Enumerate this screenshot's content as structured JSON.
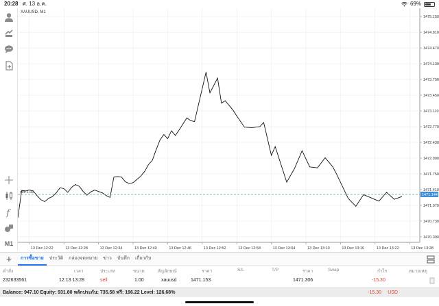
{
  "status": {
    "time": "20:28",
    "date": "ศ. 13 ธ.ค.",
    "battery": "69%",
    "battery_level": 0.69
  },
  "chart": {
    "symbol_label": "XAUUSD, M1",
    "price_line_label": "sell 1.00",
    "colors": {
      "line": "#111111",
      "price_line": "#5d9d9d",
      "current_price_bg": "#3c8cd6",
      "grid": "#e8e8e8"
    }
  },
  "chart_data": {
    "type": "line",
    "title": "XAUUSD, M1",
    "xlabel": "",
    "ylabel": "",
    "ylim": [
      1470.27,
      1475.33
    ],
    "y_ticks": [
      "1475.150",
      "1474.810",
      "1474.470",
      "1474.130",
      "1473.790",
      "1473.450",
      "1473.110",
      "1472.770",
      "1472.430",
      "1472.090",
      "1471.750",
      "1471.410",
      "1471.070",
      "1470.730",
      "1470.390"
    ],
    "x_ticks": [
      "13 Dec 12:22",
      "13 Dec 12:28",
      "13 Dec 12:34",
      "13 Dec 12:40",
      "13 Dec 12:46",
      "13 Dec 12:52",
      "13 Dec 12:58",
      "13 Dec 13:04",
      "13 Dec 13:10",
      "13 Dec 13:16",
      "13 Dec 13:22",
      "13 Dec 13:28"
    ],
    "x_tick_bar_index": [
      3,
      12,
      21,
      30,
      39,
      48,
      57,
      66,
      75,
      84,
      93,
      102
    ],
    "price_line": 1471.306,
    "current_price_label": "1471.144",
    "series": [
      {
        "values": [
          1470.8,
          1471.39,
          1471.38,
          1471.4,
          1471.38,
          1471.28,
          1471.19,
          1471.15,
          1471.22,
          1471.26,
          1471.34,
          1471.45,
          1471.43,
          1471.35,
          1471.46,
          1471.52,
          1471.48,
          1471.37,
          1471.29,
          1471.36,
          1471.4,
          1471.37,
          1471.34,
          1471.28,
          1471.24,
          1471.68,
          1471.69,
          1471.68,
          1471.58,
          1471.54,
          1471.56,
          1471.63,
          1471.7,
          1471.8,
          1471.95,
          1472.04,
          1472.27,
          1472.48,
          1472.6,
          1472.51,
          1472.68,
          1472.58,
          1472.7,
          1472.83,
          1472.96,
          1472.9,
          1472.88,
          1473.95,
          1473.5,
          1473.82,
          1473.28,
          1473.33,
          1473.13,
          1473.0,
          1472.76,
          1472.75,
          1472.77,
          1472.86,
          1472.15,
          1472.34,
          1471.57,
          1471.86,
          1472.25,
          1471.9,
          1471.88,
          1472.1,
          1471.9,
          1471.74,
          1471.22,
          1471.05,
          1471.3,
          1471.23,
          1471.16,
          1471.35,
          1471.2,
          1471.26
        ]
      }
    ],
    "series_bar_index": [
      0,
      1,
      2,
      3,
      4,
      5,
      6,
      7,
      8,
      9,
      10,
      11,
      12,
      13,
      14,
      15,
      16,
      17,
      18,
      19,
      20,
      21,
      22,
      23,
      24,
      25,
      26,
      27,
      28,
      29,
      30,
      31,
      32,
      33,
      34,
      35,
      36,
      37,
      38,
      39,
      40,
      41,
      42,
      43,
      44,
      45,
      46,
      49,
      50,
      52,
      53,
      54,
      56,
      57,
      59,
      61,
      63,
      64,
      66,
      67,
      70,
      72,
      74,
      76,
      78,
      80,
      82,
      83,
      86,
      88,
      90,
      92,
      94,
      96,
      98,
      100
    ],
    "grid": true
  },
  "toolbar": {
    "items": [
      {
        "name": "account-icon"
      },
      {
        "name": "trade-icon"
      },
      {
        "name": "chat-icon"
      },
      {
        "name": "new-order-icon"
      },
      {
        "name": "crosshair-icon"
      },
      {
        "name": "chart-type-icon"
      },
      {
        "name": "indicators-icon"
      },
      {
        "name": "objects-icon"
      }
    ],
    "timeframe": "M1"
  },
  "terminal": {
    "tabs": [
      "การซื้อขาย",
      "ประวัติ",
      "กล่องจดหมาย",
      "ข่าว",
      "บันทึก",
      "เกี่ยวกับ"
    ],
    "columns": {
      "order": "คำสั่ง",
      "time": "เวลา",
      "type": "ประเภท",
      "volume": "ขนาด",
      "symbol": "สัญลักษณ์",
      "price": "ราคา",
      "sl": "S/L",
      "tp": "T/P",
      "price2": "ราคา",
      "swap": "Swap",
      "profit": "กำไร",
      "comment": "หมายเหตุ"
    },
    "row": {
      "order": "232633561",
      "time": "12.13 13:28",
      "type": "sell",
      "volume": "1.00",
      "symbol": "xauusd",
      "price": "1471.153",
      "price2": "1471.306",
      "profit": "-15.30"
    },
    "balance": "Balance: 947.10 Equity: 931.80 หลักประกัน: 735.58 ฟรี: 196.22 Level: 126.68%",
    "total_profit": "-15.30",
    "currency": "USD"
  }
}
